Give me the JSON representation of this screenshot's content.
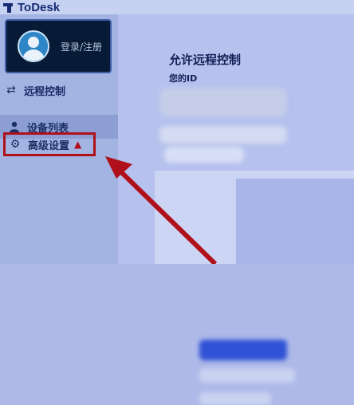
{
  "app": {
    "name": "ToDesk"
  },
  "sidebar": {
    "login_label": "登录/注册",
    "items": [
      {
        "label": "远程控制",
        "icon": "swap-arrows-icon"
      },
      {
        "label": "设备列表",
        "icon": "user-icon"
      },
      {
        "label": "高级设置",
        "icon": "gear-icon"
      }
    ]
  },
  "main": {
    "title": "允许远程控制",
    "id_label": "您的ID"
  },
  "annotation": {
    "color": "#b0101a"
  }
}
